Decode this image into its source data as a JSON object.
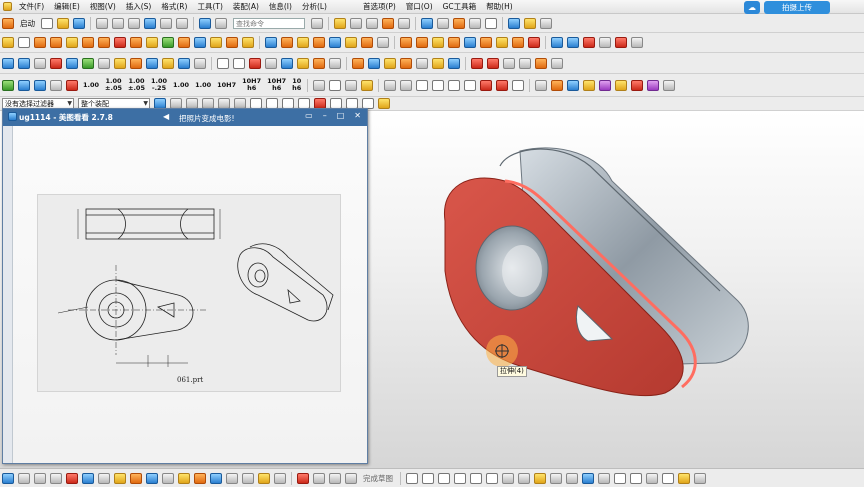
{
  "menu": {
    "items": [
      "文件(F)",
      "编辑(E)",
      "视图(V)",
      "插入(S)",
      "格式(R)",
      "工具(T)",
      "装配(A)",
      "信息(I)",
      "分析(L)",
      "首选项(P)",
      "窗口(O)",
      "GC工具箱",
      "帮助(H)"
    ]
  },
  "upload": {
    "label": "拍摄上传"
  },
  "toolbar": {
    "start_label": "启动",
    "command_search_placeholder": "查找命令",
    "selection_filter": "没有选择过滤器",
    "assembly_scope": "整个装配",
    "dim_labels": [
      "1.00",
      "1.00\n±.05",
      "1.00\n±.05",
      "1.00\n-.25",
      "1.00",
      "1.00",
      "10H7",
      "10H7\nh6",
      "10H7\nh6",
      "10\nh6"
    ]
  },
  "viewer": {
    "title": "ug1114 - 美图看看 2.7.8",
    "caption": "把照片变成电影!",
    "file_label": "061.prt"
  },
  "viewport": {
    "hint": "拉伸(4)"
  },
  "bottom": {
    "tool_label": "完成草图"
  },
  "colors": {
    "title_bar": "#3d6fa4",
    "model_face": "#c8453a",
    "model_body": "#9aa4ad",
    "upload_button": "#2f8fdc"
  }
}
